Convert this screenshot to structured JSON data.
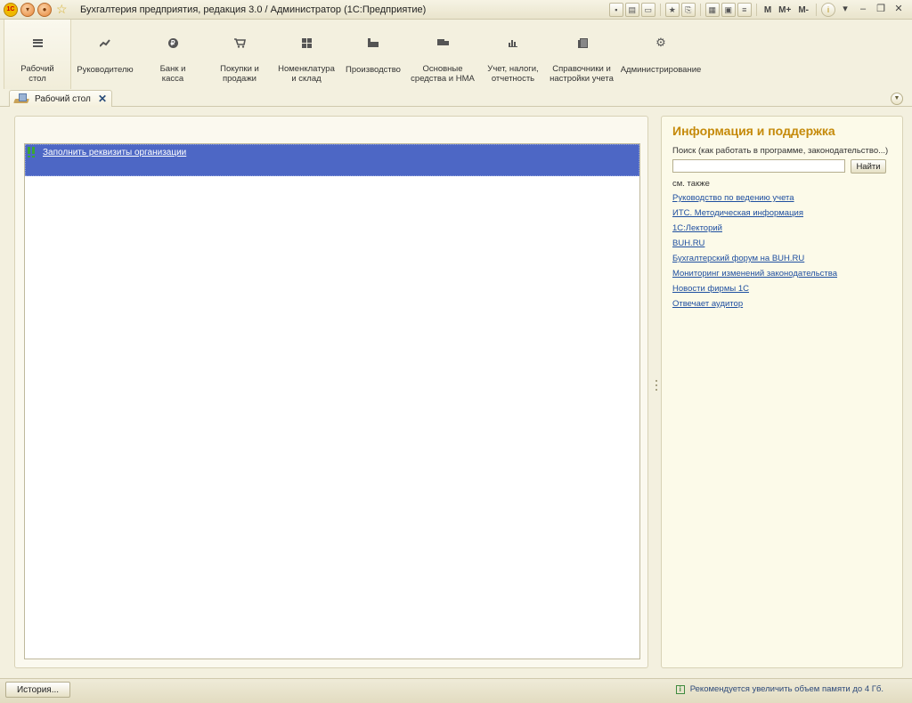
{
  "window": {
    "title": "Бухгалтерия предприятия, редакция 3.0 / Администратор  (1С:Предприятие)",
    "logo_text": "1C",
    "memory_buttons": [
      "M",
      "M+",
      "M-"
    ],
    "info_glyph": "i"
  },
  "sections": [
    {
      "label": "Рабочий\nстол",
      "icon": "menu-lines-icon"
    },
    {
      "label": "Руководителю",
      "icon": "trend-chart-icon"
    },
    {
      "label": "Банк и\nкасса",
      "icon": "ruble-coin-icon",
      "glyph": "₽"
    },
    {
      "label": "Покупки и\nпродажи",
      "icon": "cart-icon"
    },
    {
      "label": "Номенклатура\nи склад",
      "icon": "grid-icon"
    },
    {
      "label": "Производство",
      "icon": "factory-icon"
    },
    {
      "label": "Основные\nсредства и НМА",
      "icon": "truck-icon"
    },
    {
      "label": "Учет, налоги,\nотчетность",
      "icon": "bar-chart-icon"
    },
    {
      "label": "Справочники и\nнастройки учета",
      "icon": "books-icon"
    },
    {
      "label": "Администрирование",
      "icon": "gear-icon"
    }
  ],
  "tab": {
    "label": "Рабочий стол"
  },
  "tasks": [
    {
      "text": "Заполнить реквизиты организации"
    }
  ],
  "info": {
    "title": "Информация и поддержка",
    "search_label": "Поиск (как работать в программе, законодательство...)",
    "search_value": "",
    "search_button": "Найти",
    "see_also": "см. также",
    "links": [
      "Руководство по ведению учета",
      "ИТС. Методическая информация",
      "1С:Лекторий",
      "BUH.RU",
      "Бухгалтерский форум на BUH.RU",
      "Мониторинг изменений законодательства",
      "Новости фирмы 1С",
      "Отвечает аудитор"
    ]
  },
  "status": {
    "history_button": "История...",
    "message": "Рекомендуется увеличить  объем памяти до 4 Гб."
  }
}
